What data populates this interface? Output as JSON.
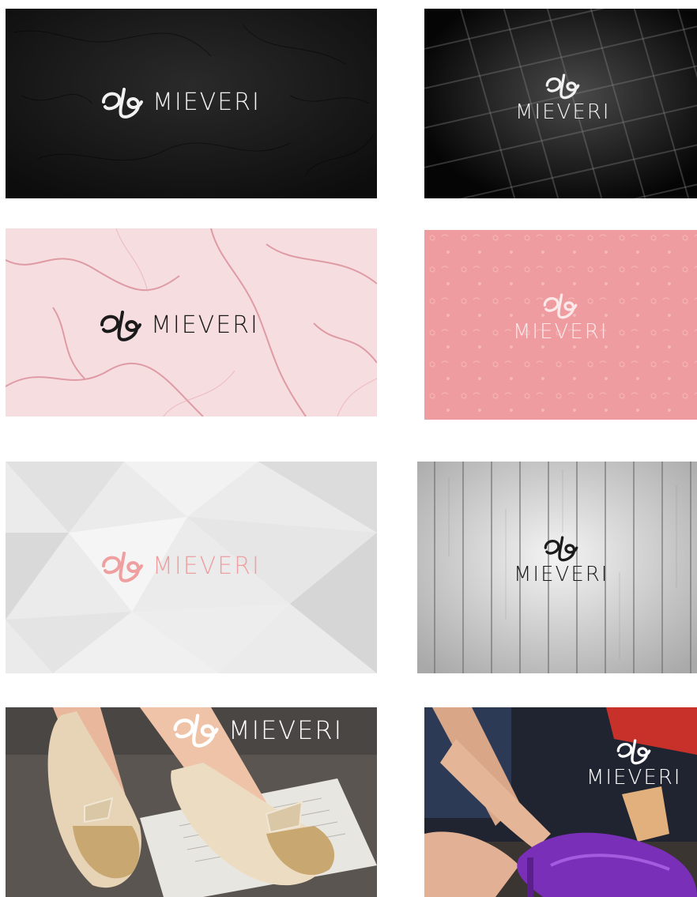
{
  "brand_name": "MIEVERI",
  "cards": [
    {
      "id": "black-leather",
      "background": "black leather texture",
      "logo_color": "#f2f2f2",
      "layout": "horizontal"
    },
    {
      "id": "black-quilted",
      "background": "black quilted tile pattern",
      "logo_color": "#f2f2f2",
      "layout": "stacked"
    },
    {
      "id": "pink-marble",
      "background": "pink marble",
      "logo_color": "#1b1b1b",
      "layout": "horizontal"
    },
    {
      "id": "pink-floral",
      "background": "pink floral pattern",
      "logo_color": "#fbe9ea",
      "layout": "stacked"
    },
    {
      "id": "grey-polygon",
      "background": "light grey low-poly",
      "logo_color": "#ef9f9f",
      "layout": "horizontal"
    },
    {
      "id": "grey-wood",
      "background": "grey wood planks",
      "logo_color": "#1b1b1b",
      "layout": "stacked"
    },
    {
      "id": "photo-flats",
      "background": "photo of legs wearing beige bow flats",
      "logo_color": "#ffffff",
      "layout": "horizontal"
    },
    {
      "id": "photo-heel",
      "background": "photo of hand fitting a purple heel",
      "logo_color": "#ffffff",
      "layout": "stacked"
    }
  ],
  "colors": {
    "page_background": "#ffffff",
    "pink_accent": "#ef9f9f",
    "black": "#1b1b1b"
  },
  "icons": [
    "monogram-icon"
  ]
}
